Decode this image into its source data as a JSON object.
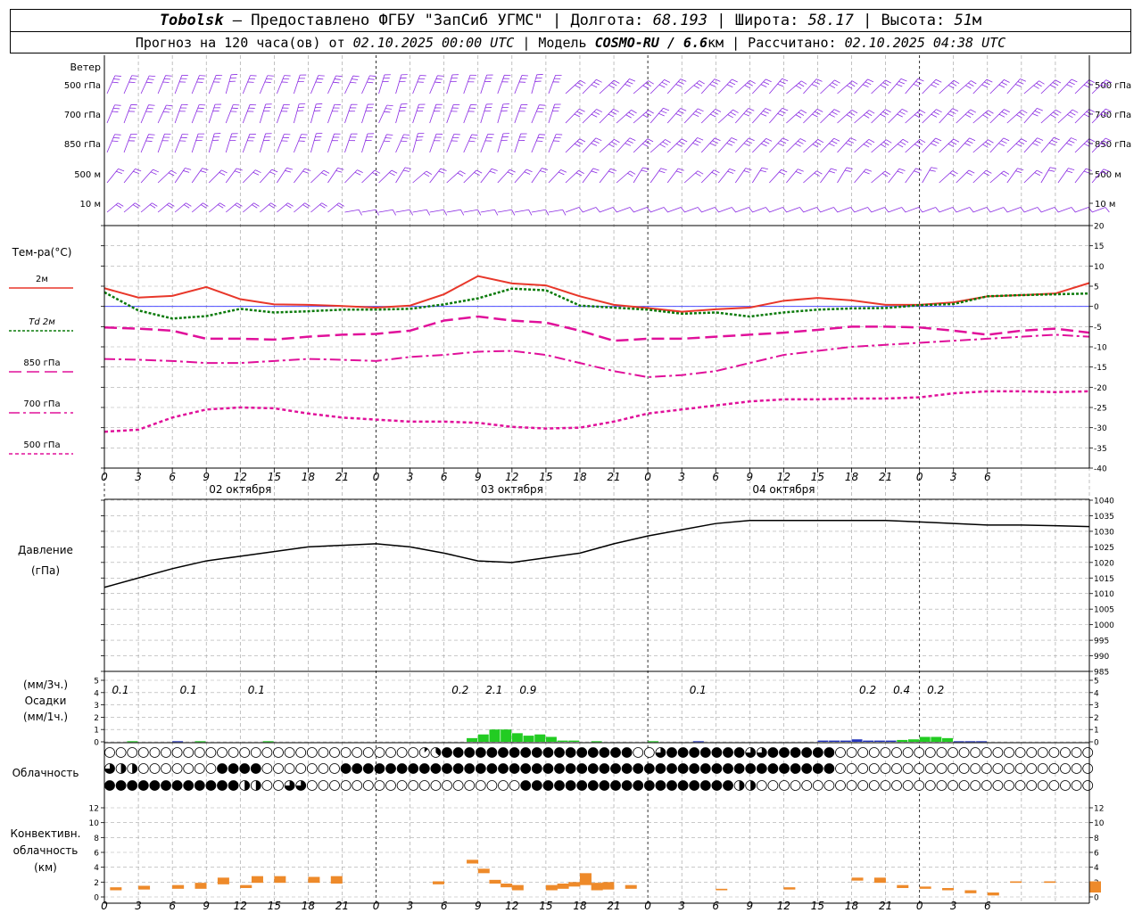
{
  "header": {
    "city": "Tobolsk",
    "provider": "— Предоставлено ФГБУ \"ЗапСиб УГМС\" |",
    "lon_label": "Долгота:",
    "lon": "68.193",
    "lat_label": "| Широта:",
    "lat": "58.17",
    "alt_label": "| Высота:",
    "alt": "51",
    "alt_unit": "м",
    "forecast_label": "Прогноз на 120 часа(ов) от",
    "forecast_start": "02.10.2025 00:00 UTC",
    "model_label": "| Модель",
    "model": "COSMO-RU / 6.6",
    "model_unit": "км",
    "calc_label": "| Рассчитано:",
    "calc_time": "02.10.2025 04:38 UTC"
  },
  "wind_panel": {
    "title": "Ветер",
    "levels": [
      "500 гПа",
      "700 гПа",
      "850 гПа",
      "500 м",
      "10  м"
    ],
    "right_levels": [
      "500 гПа",
      "700 гПа",
      "850 гПа",
      "500 м",
      "10 м"
    ],
    "color": "#8a2be2"
  },
  "temp_panel": {
    "title": "Тем-ра(°C)",
    "legend": [
      {
        "label": "2м",
        "color": "#e8372a",
        "style": "solid"
      },
      {
        "label": "Td  2м",
        "color": "#0a7a0a",
        "style": "dotted"
      },
      {
        "label": "850 гПа",
        "color": "#e0109a",
        "style": "longdash"
      },
      {
        "label": "700 гПа",
        "color": "#e0109a",
        "style": "dashdot"
      },
      {
        "label": "500 гПа",
        "color": "#e0109a",
        "style": "dashed"
      }
    ],
    "yticks": [
      "20",
      "15",
      "10",
      "5",
      "0",
      "-5",
      "-10",
      "-15",
      "-20",
      "-25",
      "-30",
      "-35",
      "-40"
    ]
  },
  "time_axis": {
    "ticks": [
      "0",
      "3",
      "6",
      "9",
      "12",
      "15",
      "18",
      "21",
      "0",
      "3",
      "6",
      "9",
      "12",
      "15",
      "18",
      "21",
      "0",
      "3",
      "6",
      "9",
      "12",
      "15",
      "18",
      "21",
      "0",
      "3",
      "6"
    ],
    "dates": [
      "02 октября",
      "03 октября",
      "04 октября"
    ]
  },
  "pressure_panel": {
    "title": "Давление",
    "unit": "(гПа)",
    "yticks": [
      "1040",
      "1035",
      "1030",
      "1025",
      "1020",
      "1015",
      "1010",
      "1005",
      "1000",
      "995",
      "990",
      "985"
    ]
  },
  "precip_panel": {
    "unit3": "(мм/3ч.)",
    "title": "Осадки",
    "unit1": "(мм/1ч.)",
    "yticks": [
      "5",
      "4",
      "3",
      "2",
      "1",
      "0"
    ],
    "totals": [
      {
        "h": 3,
        "label": "0.1"
      },
      {
        "h": 9,
        "label": "0.1"
      },
      {
        "h": 15,
        "label": "0.1"
      },
      {
        "h": 33,
        "label": "0.2"
      },
      {
        "h": 36,
        "label": "2.1"
      },
      {
        "h": 39,
        "label": "0.9"
      },
      {
        "h": 54,
        "label": "0.1"
      },
      {
        "h": 69,
        "label": "0.2"
      },
      {
        "h": 72,
        "label": "0.4"
      },
      {
        "h": 75,
        "label": "0.2"
      }
    ]
  },
  "cloud_panel": {
    "title": "Облачность"
  },
  "conv_panel": {
    "title1": "Конвективн.",
    "title2": "облачность",
    "unit": "(км)",
    "yticks": [
      "12",
      "10",
      "8",
      "6",
      "4",
      "2",
      "0"
    ]
  },
  "chart_data": [
    {
      "type": "line",
      "name": "temperature",
      "x_unit": "hours from 02.10.2025 00:00 UTC",
      "x": [
        0,
        3,
        6,
        9,
        12,
        15,
        18,
        21,
        24,
        27,
        30,
        33,
        36,
        39,
        42,
        45,
        48,
        51,
        54,
        57,
        60,
        63,
        66,
        69,
        72,
        75,
        78,
        81,
        84,
        87
      ],
      "ylim": [
        -40,
        20
      ],
      "series": [
        {
          "name": "2м",
          "values": [
            4.5,
            2.2,
            2.6,
            4.8,
            1.8,
            0.5,
            0.4,
            0.1,
            -0.3,
            0.2,
            3.0,
            7.5,
            5.7,
            5.2,
            2.5,
            0.4,
            -0.4,
            -1.3,
            -0.7,
            -0.3,
            1.4,
            2.1,
            1.5,
            0.4,
            0.4,
            1.0,
            2.5,
            2.8,
            3.2,
            5.8
          ]
        },
        {
          "name": "Td 2м",
          "values": [
            3.5,
            -1.0,
            -3.0,
            -2.4,
            -0.6,
            -1.5,
            -1.2,
            -0.8,
            -0.8,
            -0.6,
            0.5,
            2.0,
            4.4,
            4.0,
            0.2,
            -0.3,
            -0.8,
            -1.8,
            -1.5,
            -2.5,
            -1.5,
            -0.8,
            -0.5,
            -0.4,
            0.3,
            0.6,
            2.5,
            2.8,
            3.0,
            3.2
          ]
        },
        {
          "name": "850 гПа",
          "values": [
            -5.2,
            -5.5,
            -6.0,
            -8.0,
            -8.0,
            -8.2,
            -7.5,
            -7.0,
            -6.8,
            -6.0,
            -3.5,
            -2.5,
            -3.5,
            -4.0,
            -6.0,
            -8.5,
            -8.0,
            -8.0,
            -7.5,
            -7.0,
            -6.5,
            -5.8,
            -5.0,
            -5.0,
            -5.2,
            -6.0,
            -7.0,
            -6.0,
            -5.5,
            -6.5
          ]
        },
        {
          "name": "700 гПа",
          "values": [
            -13.0,
            -13.2,
            -13.5,
            -14.0,
            -14.0,
            -13.5,
            -13.0,
            -13.2,
            -13.5,
            -12.5,
            -12.0,
            -11.2,
            -11.0,
            -12.0,
            -14.0,
            -16.0,
            -17.5,
            -17.0,
            -16.0,
            -14.0,
            -12.0,
            -11.0,
            -10.0,
            -9.5,
            -9.0,
            -8.5,
            -8.0,
            -7.5,
            -7.0,
            -7.5
          ]
        },
        {
          "name": "500 гПа",
          "values": [
            -31.0,
            -30.5,
            -27.5,
            -25.5,
            -25.0,
            -25.2,
            -26.5,
            -27.5,
            -28.0,
            -28.5,
            -28.5,
            -28.8,
            -29.8,
            -30.2,
            -30.0,
            -28.5,
            -26.5,
            -25.5,
            -24.5,
            -23.5,
            -23.0,
            -23.0,
            -22.8,
            -22.8,
            -22.5,
            -21.5,
            -21.0,
            -21.0,
            -21.2,
            -21.0
          ]
        }
      ]
    },
    {
      "type": "line",
      "name": "pressure",
      "x_unit": "hours from 02.10.2025 00:00 UTC",
      "x": [
        0,
        3,
        6,
        9,
        12,
        15,
        18,
        21,
        24,
        27,
        30,
        33,
        36,
        39,
        42,
        45,
        48,
        51,
        54,
        57,
        60,
        63,
        66,
        69,
        72,
        75,
        78,
        81,
        84,
        87
      ],
      "ylim": [
        985,
        1040
      ],
      "values": [
        1012,
        1015,
        1018,
        1020.5,
        1022,
        1023.5,
        1025,
        1025.5,
        1026,
        1025,
        1023,
        1020.5,
        1020,
        1021.5,
        1023,
        1026,
        1028.5,
        1030.5,
        1032.5,
        1033.5,
        1033.5,
        1033.5,
        1033.5,
        1033.5,
        1033,
        1032.5,
        1032,
        1032,
        1031.8,
        1031.5
      ]
    },
    {
      "type": "bar",
      "name": "precipitation",
      "x_unit": "hours from 02.10.2025 00:00 UTC",
      "ylim": [
        0,
        5
      ],
      "green": [
        [
          2,
          0.05
        ],
        [
          8,
          0.05
        ],
        [
          14,
          0.05
        ],
        [
          32,
          0.3
        ],
        [
          33,
          0.6
        ],
        [
          34,
          1.0
        ],
        [
          35,
          1.0
        ],
        [
          36,
          0.7
        ],
        [
          37,
          0.5
        ],
        [
          38,
          0.6
        ],
        [
          39,
          0.4
        ],
        [
          40,
          0.1
        ],
        [
          41,
          0.1
        ],
        [
          43,
          0.05
        ],
        [
          48,
          0.05
        ],
        [
          70,
          0.15
        ],
        [
          71,
          0.2
        ],
        [
          72,
          0.4
        ],
        [
          73,
          0.4
        ],
        [
          74,
          0.3
        ]
      ],
      "blue": [
        [
          6,
          0.05
        ],
        [
          52,
          0.05
        ],
        [
          63,
          0.1
        ],
        [
          64,
          0.1
        ],
        [
          65,
          0.1
        ],
        [
          66,
          0.2
        ],
        [
          67,
          0.1
        ],
        [
          68,
          0.1
        ],
        [
          69,
          0.1
        ],
        [
          75,
          0.05
        ],
        [
          76,
          0.05
        ],
        [
          77,
          0.05
        ]
      ]
    },
    {
      "type": "table",
      "name": "cloudiness",
      "rows_note": "octas 0-8 for three cloud layers, one symbol per hour",
      "rows": [
        "00000000000000000000000000001388888888888888888006888888866888888000000000000000000000000000880000000000000000000000000000000000000000000",
        "64400000008888000000088888888888888888888888888888888888888888888000000000000000000000000000000000000000000000000000000000000000000000000",
        "88888888888844006600000000000000000008888888888888888888440000000000000000000000000000000000000000000000000000000000000000000000000000000"
      ]
    },
    {
      "type": "bar",
      "name": "convective cloud",
      "x_unit": "hours from 02.10.2025 00:00 UTC",
      "ylim": [
        0,
        13
      ],
      "bars": [
        [
          0.5,
          0.9,
          1.3
        ],
        [
          3,
          1.0,
          1.5
        ],
        [
          6,
          1.1,
          1.6
        ],
        [
          8,
          1.1,
          1.9
        ],
        [
          10,
          1.7,
          2.6
        ],
        [
          12,
          1.2,
          1.6
        ],
        [
          13,
          1.9,
          2.8
        ],
        [
          15,
          1.9,
          2.8
        ],
        [
          18,
          1.9,
          2.7
        ],
        [
          20,
          1.8,
          2.8
        ],
        [
          29,
          1.7,
          2.1
        ],
        [
          32,
          4.5,
          5.0
        ],
        [
          33,
          3.2,
          3.8
        ],
        [
          34,
          1.8,
          2.3
        ],
        [
          35,
          1.3,
          1.8
        ],
        [
          36,
          0.9,
          1.6
        ],
        [
          39,
          0.9,
          1.6
        ],
        [
          40,
          1.1,
          1.8
        ],
        [
          41,
          1.4,
          2.0
        ],
        [
          42,
          1.6,
          3.2
        ],
        [
          43,
          0.9,
          1.9
        ],
        [
          44,
          1.0,
          2.0
        ],
        [
          46,
          1.1,
          1.6
        ],
        [
          54,
          0.9,
          1.1
        ],
        [
          60,
          1.0,
          1.3
        ],
        [
          66,
          2.2,
          2.6
        ],
        [
          68,
          1.9,
          2.6
        ],
        [
          70,
          1.2,
          1.6
        ],
        [
          72,
          1.1,
          1.4
        ],
        [
          74,
          0.9,
          1.2
        ],
        [
          76,
          0.5,
          0.9
        ],
        [
          78,
          0.2,
          0.6
        ],
        [
          80,
          1.9,
          2.1
        ],
        [
          83,
          1.9,
          2.1
        ],
        [
          87,
          0.6,
          2.1
        ]
      ]
    }
  ]
}
